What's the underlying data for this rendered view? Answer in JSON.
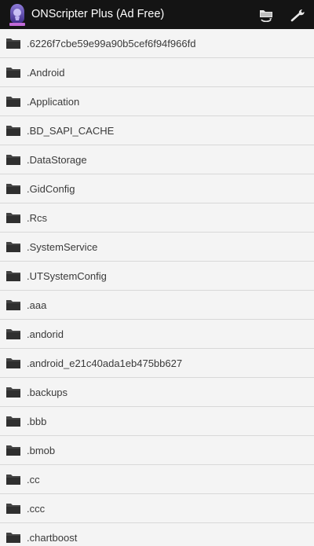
{
  "app": {
    "title": "ONScripter Plus (Ad Free)",
    "icon": "app-logo-icon"
  },
  "actions": {
    "folder_icon": "folder-refresh-icon",
    "settings_icon": "wrench-icon"
  },
  "colors": {
    "actionbar_bg": "#141414",
    "list_bg": "#f4f4f4",
    "divider": "#d8d8d8",
    "text": "#3a3a3a"
  },
  "folders": [
    {
      "name": ".6226f7cbe59e99a90b5cef6f94f966fd"
    },
    {
      "name": ".Android"
    },
    {
      "name": ".Application"
    },
    {
      "name": ".BD_SAPI_CACHE"
    },
    {
      "name": ".DataStorage"
    },
    {
      "name": ".GidConfig"
    },
    {
      "name": ".Rcs"
    },
    {
      "name": ".SystemService"
    },
    {
      "name": ".UTSystemConfig"
    },
    {
      "name": ".aaa"
    },
    {
      "name": ".andorid"
    },
    {
      "name": ".android_e21c40ada1eb475bb627"
    },
    {
      "name": ".backups"
    },
    {
      "name": ".bbb"
    },
    {
      "name": ".bmob"
    },
    {
      "name": ".cc"
    },
    {
      "name": ".ccc"
    },
    {
      "name": ".chartboost"
    }
  ]
}
